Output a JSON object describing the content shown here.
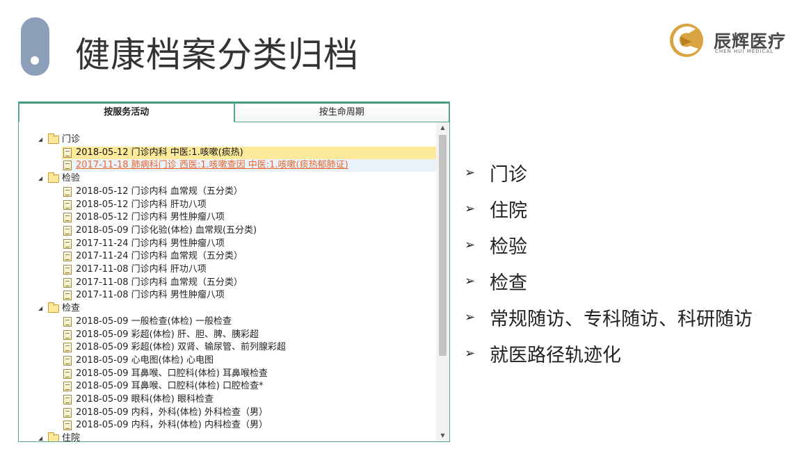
{
  "slide": {
    "title": "健康档案分类归档"
  },
  "logo": {
    "name_cn": "辰辉医疗",
    "name_en": "CHEN HUI MEDICAL"
  },
  "tabs": [
    {
      "label": "按服务活动",
      "active": true
    },
    {
      "label": "按生命周期",
      "active": false
    }
  ],
  "tree": {
    "groups": [
      {
        "label": "门诊",
        "expanded": true,
        "items": [
          {
            "text": "2018-05-12 门诊内科 中医:1.咳嗽(痰热)",
            "state": "selected"
          },
          {
            "text": "2017-11-18 肺病科门诊 西医:1.咳嗽查因 中医:1.咳嗽(痰热郁肺证)",
            "state": "hover"
          }
        ]
      },
      {
        "label": "检验",
        "expanded": true,
        "items": [
          {
            "text": "2018-05-12 门诊内科 血常规（五分类）"
          },
          {
            "text": "2018-05-12 门诊内科 肝功八项"
          },
          {
            "text": "2018-05-12 门诊内科 男性肿瘤八项"
          },
          {
            "text": "2018-05-09 门诊化验(体检) 血常规(五分类)"
          },
          {
            "text": "2017-11-24 门诊内科 男性肿瘤八项"
          },
          {
            "text": "2017-11-24 门诊内科 血常规（五分类）"
          },
          {
            "text": "2017-11-08 门诊内科 肝功八项"
          },
          {
            "text": "2017-11-08 门诊内科 血常规（五分类）"
          },
          {
            "text": "2017-11-08 门诊内科 男性肿瘤八项"
          }
        ]
      },
      {
        "label": "检查",
        "expanded": true,
        "items": [
          {
            "text": "2018-05-09 一般检查(体检) 一般检查"
          },
          {
            "text": "2018-05-09 彩超(体检) 肝、胆、脾、胰彩超"
          },
          {
            "text": "2018-05-09 彩超(体检) 双肾、输尿管、前列腺彩超"
          },
          {
            "text": "2018-05-09 心电图(体检) 心电图"
          },
          {
            "text": "2018-05-09 耳鼻喉、口腔科(体检) 耳鼻喉检查"
          },
          {
            "text": "2018-05-09 耳鼻喉、口腔科(体检) 口腔检查*"
          },
          {
            "text": "2018-05-09 眼科(体检) 眼科检查"
          },
          {
            "text": "2018-05-09 内科，外科(体检) 外科检查（男）"
          },
          {
            "text": "2018-05-09 内科，外科(体检) 内科检查（男）"
          }
        ]
      },
      {
        "label": "住院",
        "expanded": true,
        "items": []
      }
    ]
  },
  "bullets": [
    "门诊",
    "住院",
    "检验",
    "检查",
    "常规随访、专科随访、科研随访",
    "就医路径轨迹化"
  ],
  "colors": {
    "accent": "#8c9fb9",
    "tab_border": "#5aa58a",
    "selected_row": "#fde99a",
    "hover_link": "#e8672d",
    "logo_gold": "#d9a441"
  },
  "icons": {
    "group": "folder-icon",
    "item": "document-icon",
    "bullet": "arrowhead-icon"
  }
}
